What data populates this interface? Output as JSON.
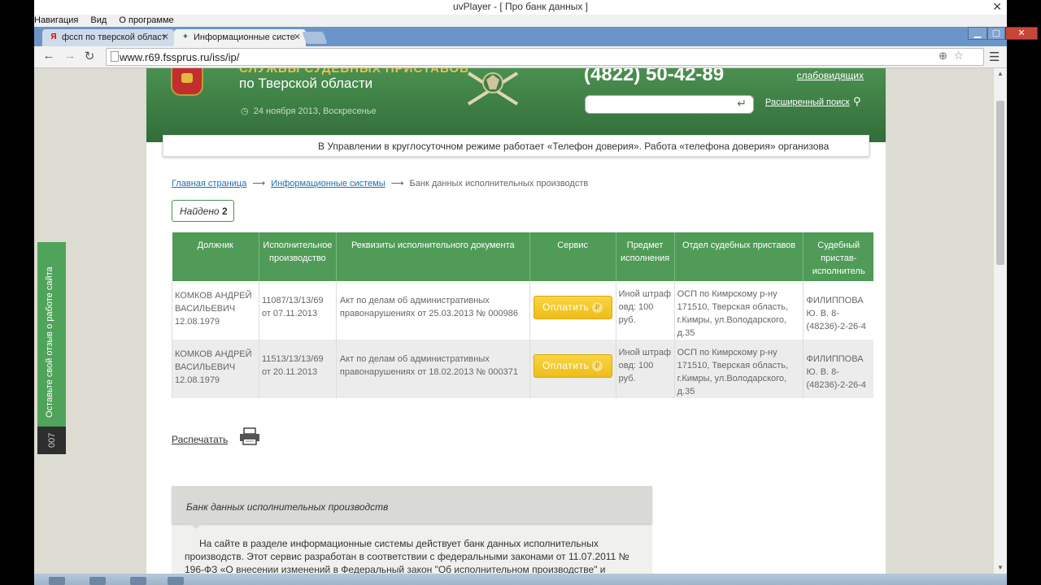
{
  "player": {
    "title": "uvPlayer - [ Про банк данных ]",
    "close_glyph": "✕",
    "menu": [
      "Навигация",
      "Вид",
      "О программе"
    ]
  },
  "browser": {
    "tabs": [
      {
        "label": "фссп по тверской област",
        "favicon": "yandex-icon",
        "active": false
      },
      {
        "label": "Информационные систе",
        "favicon": "fssp-emblem-icon",
        "active": true
      }
    ],
    "url": "www.r69.fssprus.ru/iss/ip/",
    "window_buttons": {
      "minimize": "▁",
      "maximize": "▢",
      "close": "✕"
    }
  },
  "site": {
    "org_name_top": "СЛУЖБЫ СУДЕБНЫХ ПРИСТАВОВ",
    "org_name": "по Тверской области",
    "date": "24 ноября 2013, Воскресенье",
    "phone": "(4822) 50-42-89",
    "bailiffs_link": "слабовидящих",
    "search_placeholder": "",
    "adv_search": "Расширенный поиск",
    "ticker": "В Управлении в круглосуточном режиме работает «Телефон доверия».     Работа «телефона доверия» организова"
  },
  "breadcrumb": {
    "home": "Главная страница",
    "systems": "Информационные системы",
    "current": "Банк данных исполнительных производств",
    "arrow": "⟶"
  },
  "found": {
    "label": "Найдено",
    "count": "2"
  },
  "table": {
    "headers": [
      "Должник",
      "Исполнительное производство",
      "Реквизиты исполнительного документа",
      "Сервис",
      "Предмет исполнения",
      "Отдел судебных приставов",
      "Судебный пристав-исполнитель"
    ],
    "rows": [
      {
        "debtor": "КОМКОВ АНДРЕЙ ВАСИЛЬЕВИЧ 12.08.1979",
        "proceeding": "11087/13/13/69 от 07.11.2013",
        "document": "Акт по делам об административных правонарушениях от 25.03.2013 № 000986",
        "pay": "Оплатить",
        "subject": "Иной штраф овд: 100 руб.",
        "department": "ОСП по Кимрскому р-ну 171510, Тверская область, г.Кимры, ул.Володарского, д.35",
        "bailiff": "ФИЛИППОВА Ю. В. 8-(48236)-2-26-4"
      },
      {
        "debtor": "КОМКОВ АНДРЕЙ ВАСИЛЬЕВИЧ 12.08.1979",
        "proceeding": "11513/13/13/69 от 20.11.2013",
        "document": "Акт по делам об административных правонарушениях от 18.02.2013 № 000371",
        "pay": "Оплатить",
        "subject": "Иной штраф овд: 100 руб.",
        "department": "ОСП по Кимрскому р-ну 171510, Тверская область, г.Кимры, ул.Володарского, д.35",
        "bailiff": "ФИЛИППОВА Ю. В. 8-(48236)-2-26-4"
      }
    ],
    "currency_glyph": "₽"
  },
  "print": {
    "label": "Распечатать"
  },
  "about": {
    "title": "Банк данных исполнительных производств",
    "text": "На сайте в разделе информационные системы действует банк данных исполнительных производств. Этот сервис разработан в соответствии с федеральными законами от 11.07.2011 № 196-ФЗ «О внесении изменений в Федеральный закон \"Об исполнительном производстве\" и"
  },
  "feedback": {
    "label": "Оставьте свой отзыв о работе сайта",
    "count": "007"
  },
  "colors": {
    "brand_green": "#4a9050",
    "table_header": "#4f9b57",
    "pay_yellow": "#f2c62a",
    "link_blue": "#1f6fb0"
  }
}
